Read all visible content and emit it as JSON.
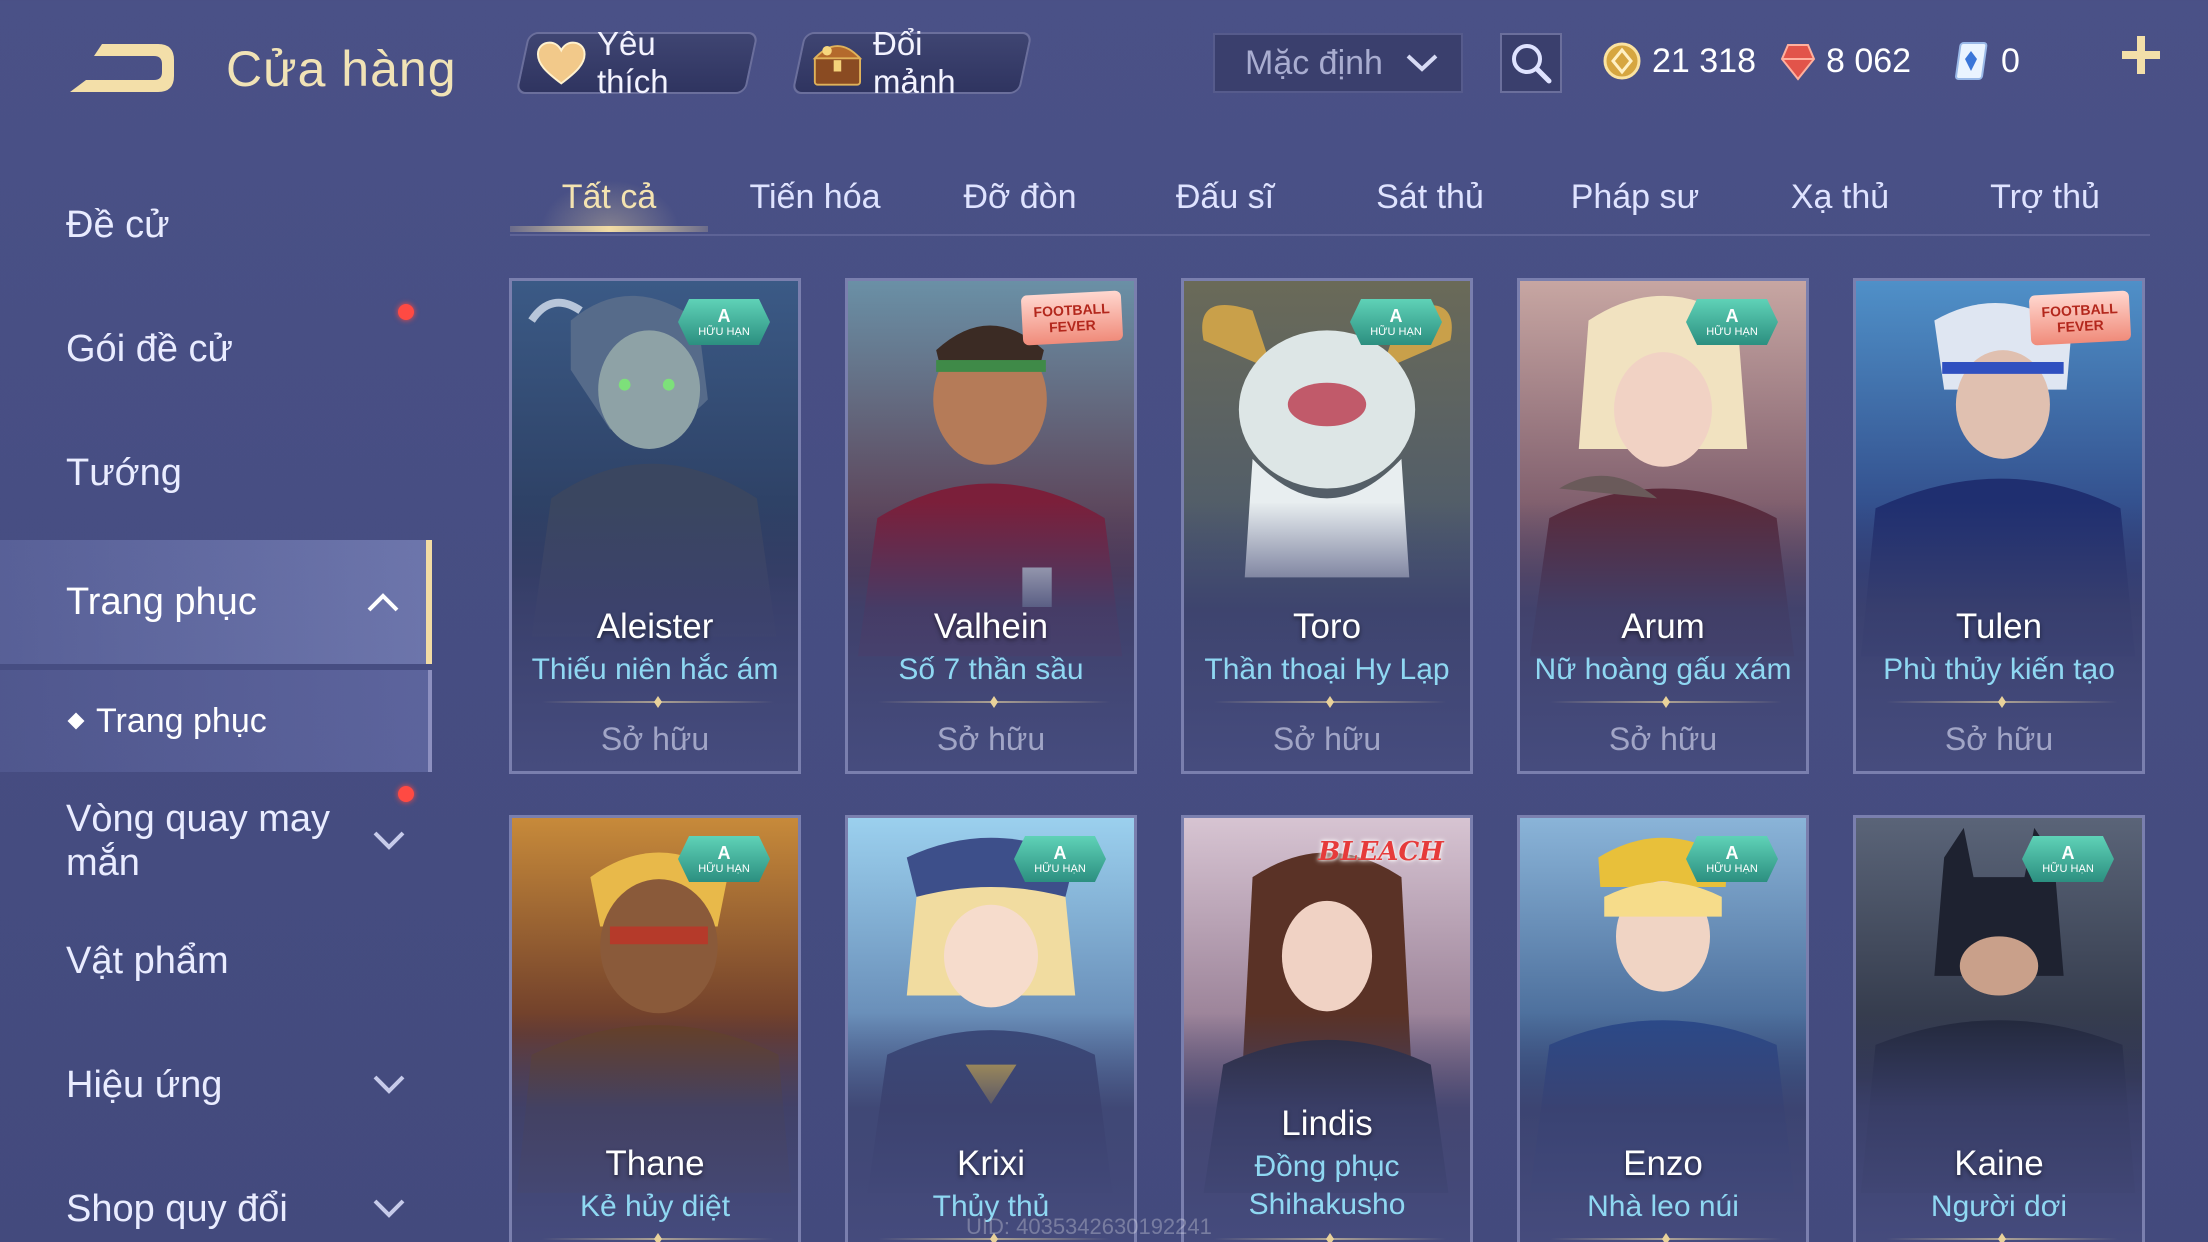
{
  "header": {
    "title": "Cửa hàng",
    "favorite_label": "Yêu thích",
    "trade_label": "Đổi mảnh",
    "sort_value": "Mặc định",
    "currencies": [
      {
        "name": "gold-coin",
        "value": "21 318"
      },
      {
        "name": "voucher",
        "value": "8 062"
      },
      {
        "name": "diamond",
        "value": "0"
      }
    ]
  },
  "sidebar": {
    "items": [
      {
        "label": "Đề cử"
      },
      {
        "label": "Gói đề cử"
      },
      {
        "label": "Tướng"
      },
      {
        "label": "Trang phục"
      },
      {
        "label": "Vòng quay may mắn"
      },
      {
        "label": "Vật phẩm"
      },
      {
        "label": "Hiệu ứng"
      },
      {
        "label": "Shop quy đổi"
      }
    ],
    "subitem": "Trang phục"
  },
  "tabs": [
    "Tất cả",
    "Tiến hóa",
    "Đỡ đòn",
    "Đấu sĩ",
    "Sát thủ",
    "Pháp sư",
    "Xạ thủ",
    "Trợ thủ"
  ],
  "badges": {
    "limited_grade": "A",
    "limited_text": "HỮU HẠN",
    "event_text": "FOOTBALL FEVER",
    "collab_text": "BLEACH"
  },
  "cards": [
    {
      "name": "Aleister",
      "skin": "Thiếu niên hắc ám",
      "status": "Sở hữu"
    },
    {
      "name": "Valhein",
      "skin": "Số 7 thần sầu",
      "status": "Sở hữu"
    },
    {
      "name": "Toro",
      "skin": "Thần thoại Hy Lạp",
      "status": "Sở hữu"
    },
    {
      "name": "Arum",
      "skin": "Nữ hoàng gấu xám",
      "status": "Sở hữu"
    },
    {
      "name": "Tulen",
      "skin": "Phù thủy kiến tạo",
      "status": "Sở hữu"
    },
    {
      "name": "Thane",
      "skin": "Kẻ hủy diệt"
    },
    {
      "name": "Krixi",
      "skin": "Thủy thủ"
    },
    {
      "name": "Lindis",
      "skin": "Đồng phục Shihakusho"
    },
    {
      "name": "Enzo",
      "skin": "Nhà leo núi"
    },
    {
      "name": "Kaine",
      "skin": "Người dơi"
    }
  ],
  "uid": "UID: 4035342630192241",
  "colors": {
    "accent": "#f2dca4",
    "skin_text": "#8fd8f2",
    "background": "#474e83",
    "notification": "#ff4a43"
  }
}
